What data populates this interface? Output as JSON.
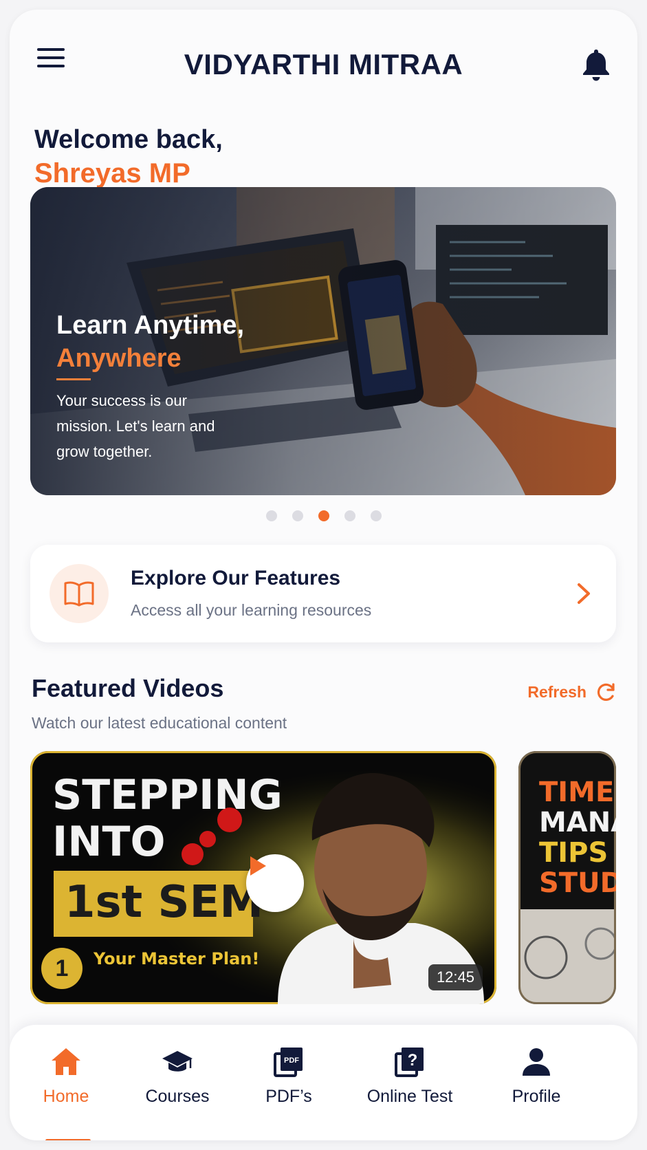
{
  "header": {
    "title": "VIDYARTHI MITRAA",
    "menu_icon": "hamburger-menu-icon",
    "notification_icon": "bell-icon"
  },
  "welcome": {
    "greeting": "Welcome back,",
    "user_name": "Shreyas MP"
  },
  "hero": {
    "title": "Learn Anytime,",
    "accent": "Anywhere",
    "subtitle": "Your success is our mission. Let's learn and grow together.",
    "slides_total": 5,
    "active_slide": 3
  },
  "feature_card": {
    "title": "Explore Our Features",
    "subtitle": "Access all your learning resources",
    "icon": "open-book-icon"
  },
  "featured_videos": {
    "title": "Featured Videos",
    "subtitle": "Watch our latest educational content",
    "refresh_label": "Refresh",
    "videos": [
      {
        "thumb_line1": "STEPPING",
        "thumb_line2": "INTO",
        "thumb_badge": "1st SEM",
        "thumb_number": "1",
        "thumb_tagline": "Your Master Plan!",
        "duration": "12:45"
      },
      {
        "thumb_line1": "TIME",
        "thumb_line2": "MANA",
        "thumb_line3": "TIPS T",
        "thumb_line4": "STUD"
      }
    ]
  },
  "bottom_nav": {
    "items": [
      {
        "label": "Home",
        "icon": "home-icon",
        "active": true
      },
      {
        "label": "Courses",
        "icon": "graduation-cap-icon",
        "active": false
      },
      {
        "label": "PDF’s",
        "icon": "pdf-icon",
        "active": false
      },
      {
        "label": "Online Test",
        "icon": "quiz-icon",
        "active": false
      },
      {
        "label": "Profile",
        "icon": "user-icon",
        "active": false
      }
    ]
  },
  "colors": {
    "accent": "#f26b2a",
    "navy": "#121a3a",
    "muted": "#6b7285",
    "gold": "#dcb432"
  }
}
